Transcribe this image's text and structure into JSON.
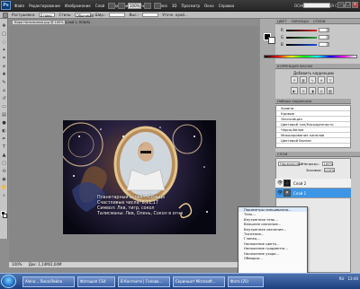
{
  "app": {
    "logo": "Ps"
  },
  "menus": [
    "Файл",
    "Редактирование",
    "Изображение",
    "Слой",
    "Выделение",
    "Фильтр",
    "Анализ",
    "3D",
    "Просмотр",
    "Окно",
    "Справка"
  ],
  "topbar": {
    "zoom": "100%",
    "workspace_label": "ОСНОВНАЯ РАБОЧАЯ СРЕДА"
  },
  "options": {
    "feather_label": "Растушевка:",
    "feather_value": "0 пикс",
    "style_label": "Стиль:",
    "style_value": "Обычный",
    "width_label": "Шир.:",
    "height_label": "Выс.:",
    "refine": "Уточн. край..."
  },
  "document": {
    "tab": "Кира Натальинка.jpg @ 100% (Слой 1, RGB/8)"
  },
  "canvas": {
    "lines": [
      "Планетарный аспект: Солнце",
      "Счастливые числа: 8,11,17",
      "Символ: Лев, тигр, сокол",
      "Талисманы: Лев, Олень, Сокол в огне"
    ]
  },
  "status": {
    "zoom": "100%",
    "doc": "Док: 1,14M/2,04M"
  },
  "right": {
    "tabs": [
      "ЦВЕТ",
      "ОБРАЗЦЫ",
      "СТИЛИ"
    ],
    "adjustments_header": "КОРРЕКЦИЯ МАСКИ",
    "adjustments_title": "Добавить коррекцию",
    "presets_header": "Наборы коррекции",
    "presets": [
      "Уровни",
      "Кривые",
      "Экспозиция",
      "Цветовой тон/Насыщенность",
      "Черно-белое",
      "Микширование каналов",
      "Цветовой баланс"
    ],
    "layers_header": "СЛОИ",
    "mode": "Нормальный",
    "opacity_label": "Непрозр.:",
    "opacity_value": "100%",
    "fill_label": "Заливка:",
    "fill_value": "100%",
    "layers": [
      {
        "name": "Слой 2",
        "selected": false
      },
      {
        "name": "Слой 1",
        "selected": true
      }
    ]
  },
  "colors": {
    "r": {
      "label": "R",
      "value": "0",
      "color": "#d62828"
    },
    "g": {
      "label": "G",
      "value": "0",
      "color": "#2a9d3e"
    },
    "b": {
      "label": "B",
      "value": "0",
      "color": "#1e4fdc"
    }
  },
  "context_menu": {
    "items": [
      "Параметры смешивания...",
      "Тень...",
      "Внутренняя тень...",
      "Внешнее свечение...",
      "Внутреннее свечение...",
      "Тиснение...",
      "Глянец...",
      "Наложение цвета...",
      "Наложение градиента...",
      "Наложение узора...",
      "Обводка..."
    ]
  },
  "taskbar": {
    "buttons": [
      "Alena... Лиса/Лейла",
      "Фотошоп CS4",
      "В Контакте | Голова...",
      "Скриншот Microsoft...",
      "Фото (25)"
    ],
    "tray": [
      "RU",
      "13:40"
    ]
  }
}
